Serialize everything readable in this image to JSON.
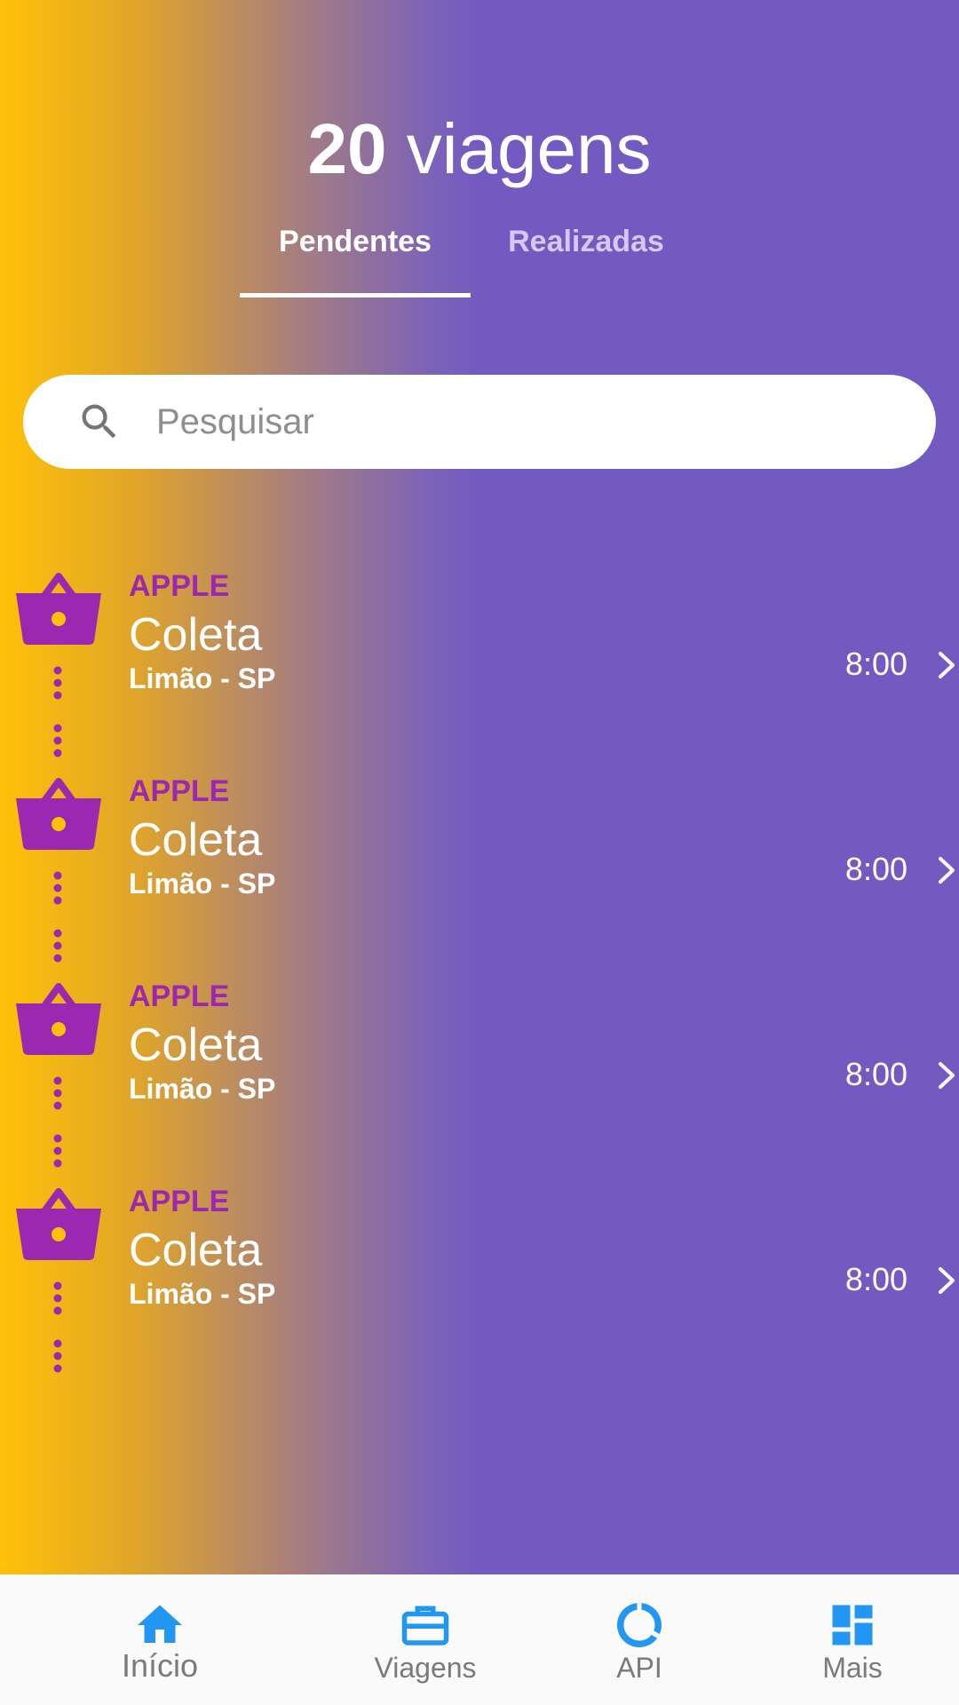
{
  "header": {
    "count": "20",
    "title_suffix": " viagens"
  },
  "tabs": [
    {
      "label": "Pendentes",
      "active": true
    },
    {
      "label": "Realizadas",
      "active": false
    }
  ],
  "search": {
    "placeholder": "Pesquisar",
    "value": ""
  },
  "trips": [
    {
      "company": "APPLE",
      "kind": "Coleta",
      "place": "Limão - SP",
      "time": "8:00",
      "icon": "basket-icon"
    },
    {
      "company": "APPLE",
      "kind": "Coleta",
      "place": "Limão - SP",
      "time": "8:00",
      "icon": "basket-icon"
    },
    {
      "company": "APPLE",
      "kind": "Coleta",
      "place": "Limão - SP",
      "time": "8:00",
      "icon": "basket-icon"
    },
    {
      "company": "APPLE",
      "kind": "Coleta",
      "place": "Limão - SP",
      "time": "8:00",
      "icon": "basket-icon"
    }
  ],
  "bottom_nav": [
    {
      "label": "Início",
      "icon": "home-icon",
      "active": true
    },
    {
      "label": "Viagens",
      "icon": "briefcase-icon",
      "active": false
    },
    {
      "label": "API",
      "icon": "donut-icon",
      "active": false
    },
    {
      "label": "Mais",
      "icon": "dashboard-icon",
      "active": false
    }
  ],
  "colors": {
    "accent": "#2196F3",
    "purple": "#735AC0",
    "yellow": "#FFC107",
    "trip_icon": "#9C27B0",
    "trip_icon_dot": "#FFC107"
  }
}
